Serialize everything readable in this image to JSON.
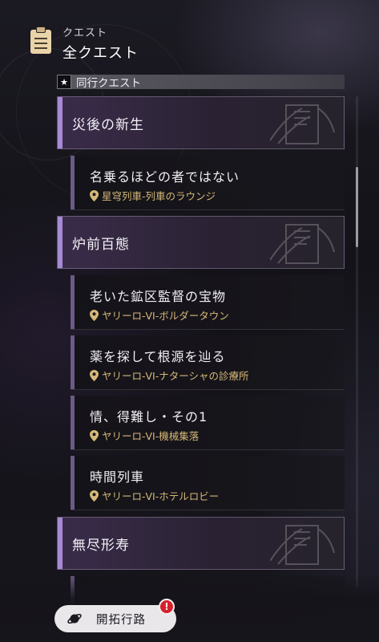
{
  "header": {
    "category": "クエスト",
    "title": "全クエスト",
    "icon": "clipboard-icon"
  },
  "section": {
    "label": "同行クエスト",
    "icon": "star-icon"
  },
  "chapters": [
    {
      "title": "災後の新生",
      "quests": [
        {
          "name": "名乗るほどの者ではない",
          "location": "星穹列車-列車のラウンジ"
        }
      ]
    },
    {
      "title": "炉前百態",
      "quests": [
        {
          "name": "老いた鉱区監督の宝物",
          "location": "ヤリーロ-VI-ボルダータウン"
        },
        {
          "name": "薬を探して根源を辿る",
          "location": "ヤリーロ-VI-ナターシャの診療所"
        },
        {
          "name": "情、得難し・その1",
          "location": "ヤリーロ-VI-機械集落"
        },
        {
          "name": "時間列車",
          "location": "ヤリーロ-VI-ホテルロビー"
        }
      ]
    },
    {
      "title": "無尽形寿",
      "quests": []
    }
  ],
  "nav_button": {
    "label": "開拓行路",
    "icon": "planet-icon",
    "badge": "!"
  },
  "colors": {
    "chapter_accent": "#a68ad6",
    "location_text": "#d6b878",
    "quest_bar": "#6b5a86",
    "badge": "#d6202c"
  }
}
